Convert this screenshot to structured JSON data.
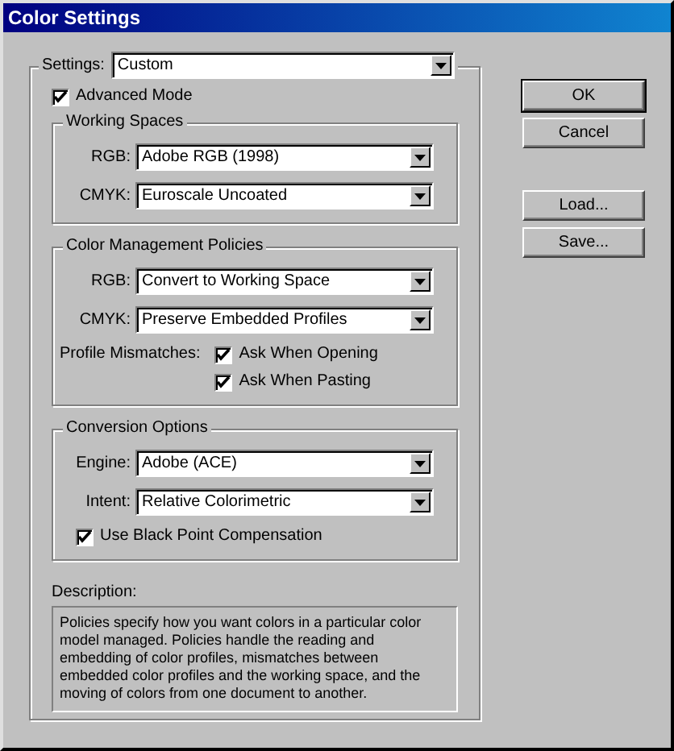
{
  "window": {
    "title": "Color Settings"
  },
  "settings": {
    "label": "Settings:",
    "value": "Custom"
  },
  "advanced_mode": {
    "label": "Advanced Mode",
    "checked": true
  },
  "groups": [
    {
      "title": "Working Spaces",
      "rows": [
        {
          "kind": "select",
          "label": "RGB:",
          "value": "Adobe RGB (1998)"
        },
        {
          "kind": "select",
          "label": "CMYK:",
          "value": "Euroscale Uncoated"
        }
      ]
    },
    {
      "title": "Color Management Policies",
      "rows": [
        {
          "kind": "select",
          "label": "RGB:",
          "value": "Convert to Working Space"
        },
        {
          "kind": "select",
          "label": "CMYK:",
          "value": "Preserve Embedded Profiles"
        },
        {
          "kind": "checks",
          "label": "Profile Mismatches:",
          "items": [
            {
              "label": "Ask When Opening",
              "checked": true
            },
            {
              "label": "Ask When Pasting",
              "checked": true
            }
          ]
        }
      ]
    },
    {
      "title": "Conversion Options",
      "rows": [
        {
          "kind": "select",
          "label": "Engine:",
          "value": "Adobe (ACE)"
        },
        {
          "kind": "select",
          "label": "Intent:",
          "value": "Relative Colorimetric"
        },
        {
          "kind": "check",
          "label": "Use Black Point Compensation",
          "checked": true
        }
      ]
    }
  ],
  "description": {
    "label": "Description:",
    "text": "Policies specify how you want colors in a particular color model managed. Policies handle the reading and embedding of color profiles, mismatches between embedded color profiles and the working space, and the moving of colors from one document to another."
  },
  "buttons": [
    {
      "label": "OK",
      "default": true
    },
    {
      "label": "Cancel",
      "default": false
    },
    {
      "label": "Load...",
      "default": false
    },
    {
      "label": "Save...",
      "default": false
    }
  ]
}
